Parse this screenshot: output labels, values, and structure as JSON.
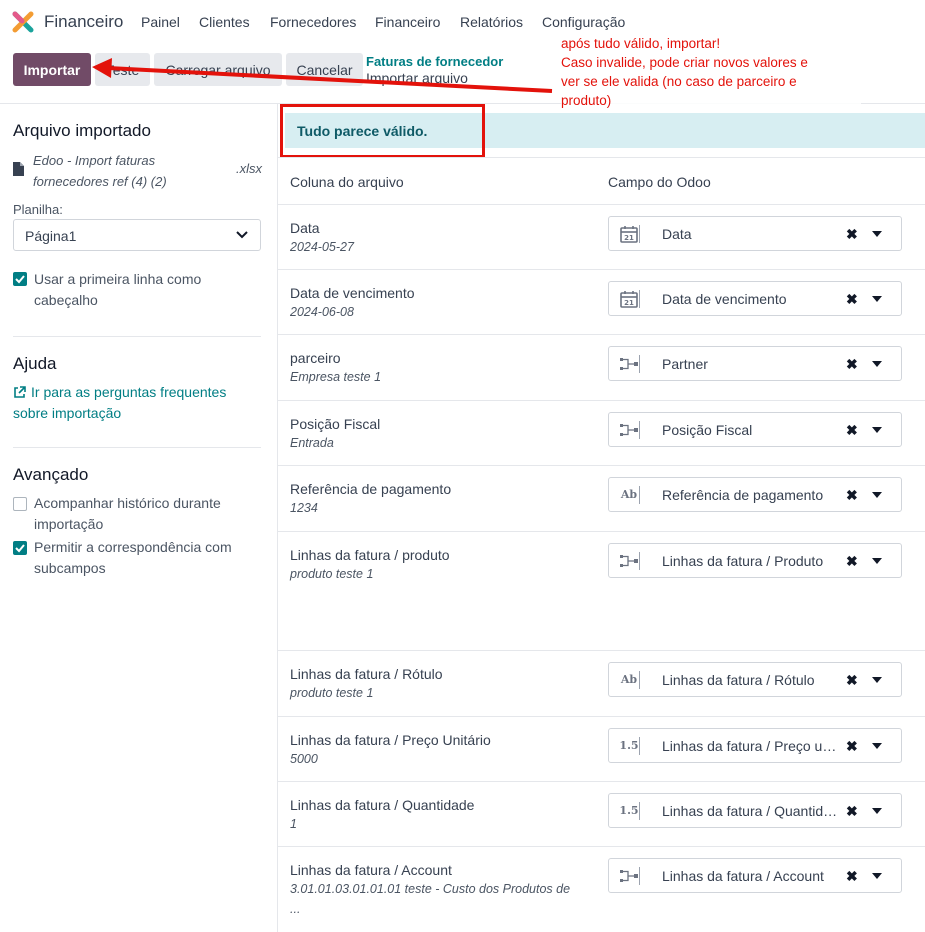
{
  "nav": {
    "app_name": "Financeiro",
    "menu": [
      "Painel",
      "Clientes",
      "Fornecedores",
      "Financeiro",
      "Relatórios",
      "Configuração"
    ]
  },
  "toolbar": {
    "import_label": "Importar",
    "test_label": "Teste",
    "upload_label": "Carregar arquivo",
    "cancel_label": "Cancelar"
  },
  "breadcrumb": {
    "parent": "Faturas de fornecedor",
    "current": "Importar arquivo"
  },
  "annotation": {
    "lines": [
      "após tudo válido, importar!",
      "Caso invalide, pode criar novos valores e",
      "ver se ele valida (no caso de parceiro e",
      "produto)"
    ],
    "color": "#e3120b"
  },
  "sidebar": {
    "imported_title": "Arquivo importado",
    "file_name": "Edoo - Import faturas fornecedores ref (4) (2)",
    "file_ext": ".xlsx",
    "sheet_label": "Planilha:",
    "sheet_value": "Página1",
    "first_row_header": "Usar a primeira linha como cabeçalho",
    "help_title": "Ajuda",
    "help_link": "Ir para as perguntas frequentes sobre importação",
    "advanced_title": "Avançado",
    "track_history": "Acompanhar histórico durante importação",
    "allow_subfields": "Permitir a correspondência com subcampos"
  },
  "main": {
    "alert": "Tudo parece válido.",
    "col_file": "Coluna do arquivo",
    "col_odoo": "Campo do Odoo",
    "rows": [
      {
        "title": "Data",
        "sample": "2024-05-27",
        "icon": "calendar-icon",
        "field": "Data"
      },
      {
        "title": "Data de vencimento",
        "sample": "2024-06-08",
        "icon": "calendar-icon",
        "field": "Data de vencimento"
      },
      {
        "title": "parceiro",
        "sample": "Empresa teste 1",
        "icon": "relation-icon",
        "field": "Partner"
      },
      {
        "title": "Posição Fiscal",
        "sample": "Entrada",
        "icon": "relation-icon",
        "field": "Posição Fiscal"
      },
      {
        "title": "Referência de pagamento",
        "sample": "1234",
        "icon": "text-icon",
        "icon_text": "Ab",
        "field": "Referência de pagamento"
      },
      {
        "title": "Linhas da fatura / produto",
        "sample": "produto teste 1",
        "icon": "relation-icon",
        "field": "Linhas da fatura / Produto"
      },
      {
        "title": "Linhas da fatura / Rótulo",
        "sample": "produto teste 1",
        "icon": "text-icon",
        "icon_text": "Ab",
        "field": "Linhas da fatura / Rótulo"
      },
      {
        "title": "Linhas da fatura / Preço Unitário",
        "sample": "5000",
        "icon": "decimal-icon",
        "icon_text": "1.5",
        "field": "Linhas da fatura / Preço unitário"
      },
      {
        "title": "Linhas da fatura / Quantidade",
        "sample": "1",
        "icon": "decimal-icon",
        "icon_text": "1.5",
        "field": "Linhas da fatura / Quantidade"
      },
      {
        "title": "Linhas da fatura / Account",
        "sample": "3.01.01.03.01.01.01 teste - Custo dos Produtos de ...",
        "icon": "relation-icon",
        "field": "Linhas da fatura / Account"
      }
    ]
  }
}
